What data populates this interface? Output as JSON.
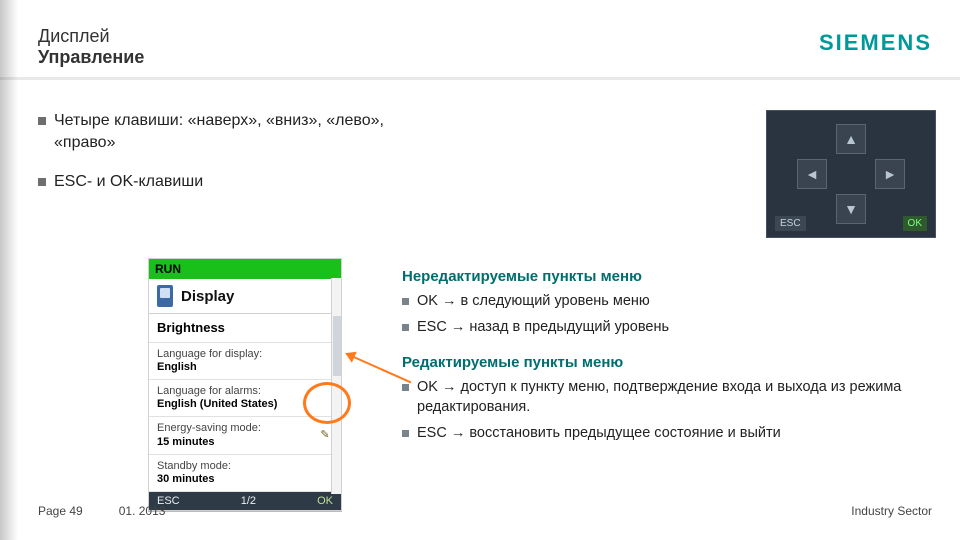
{
  "header": {
    "line1": "Дисплей",
    "line2": "Управление",
    "brand": "SIEMENS"
  },
  "bullets": {
    "b1a": "Четыре клавиши: «наверх», «вниз», «лево»,",
    "b1b": "«право»",
    "b2": "ESC-  и OK-клавиши"
  },
  "dpad": {
    "up": "▲",
    "down": "▼",
    "left": "◄",
    "right": "►",
    "esc": "ESC",
    "ok": "OK"
  },
  "device": {
    "run": "RUN",
    "display": "Display",
    "brightness": "Brightness",
    "rows": [
      {
        "k": "Language for display:",
        "v": "English",
        "pencil": false
      },
      {
        "k": "Language for alarms:",
        "v": "English (United States)",
        "pencil": false
      },
      {
        "k": "Energy-saving mode:",
        "v": "15 minutes",
        "pencil": true
      },
      {
        "k": "Standby mode:",
        "v": "30 minutes",
        "pencil": false
      }
    ],
    "footer": {
      "esc": "ESC",
      "page": "1/2",
      "ok": "OK"
    }
  },
  "explain": {
    "h1": "Нередактируемые пункты меню",
    "p1": "OK → в следующий уровень меню",
    "p2": "ESC → назад в предыдущий уровень",
    "h2": "Редактируемые пункты меню",
    "p3": "OK → доступ к пункту меню, подтверждение входа и выхода из режима редактирования.",
    "p4": "ESC → восстановить предыдущее состояние и выйти"
  },
  "foot": {
    "page": "Page 49",
    "date": "01. 2013",
    "sector": "Industry Sector"
  }
}
